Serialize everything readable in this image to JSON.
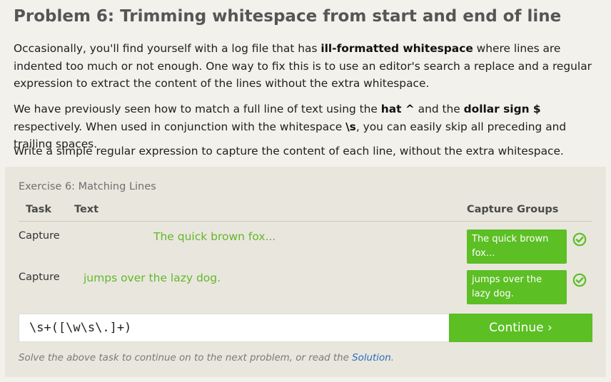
{
  "header": {
    "title": "Problem 6: Trimming whitespace from start and end of line"
  },
  "intro": {
    "p1_a": "Occasionally, you'll find yourself with a log file that has ",
    "p1_b": "ill-formatted whitespace",
    "p1_c": " where lines are indented too much or not enough. One way to fix this is to use an editor's search a replace and a regular expression to extract the content of the lines without the extra whitespace.",
    "p2_a": "We have previously seen how to match a full line of text using the ",
    "p2_b": "hat ^",
    "p2_c": " and the ",
    "p2_d": "dollar sign $",
    "p2_e": " respectively. When used in conjunction with the whitespace ",
    "p2_f": "\\s",
    "p2_g": ", you can easily skip all preceding and trailing spaces.",
    "p3": "Write a simple regular expression to capture the content of each line, without the extra whitespace."
  },
  "exercise": {
    "title": "Exercise 6: Matching Lines",
    "columns": {
      "task": "Task",
      "text": "Text",
      "groups": "Capture Groups"
    },
    "rows": [
      {
        "task": "Capture",
        "text": "The quick brown fox...",
        "group": "The quick brown fox...",
        "status": "check-icon"
      },
      {
        "task": "Capture",
        "text": "jumps over the lazy dog.",
        "group": "jumps over the lazy dog.",
        "status": "check-icon"
      }
    ],
    "regex_value": "\\s+([\\w\\s\\.]+)",
    "continue_label": "Continue ›",
    "footer_a": "Solve the above task to continue on to the next problem, or read the ",
    "footer_link": "Solution",
    "footer_b": "."
  },
  "colors": {
    "accent": "#5cbf24",
    "link": "#2a6fb8",
    "panel": "#e9e6de",
    "page": "#f3f1ec"
  }
}
